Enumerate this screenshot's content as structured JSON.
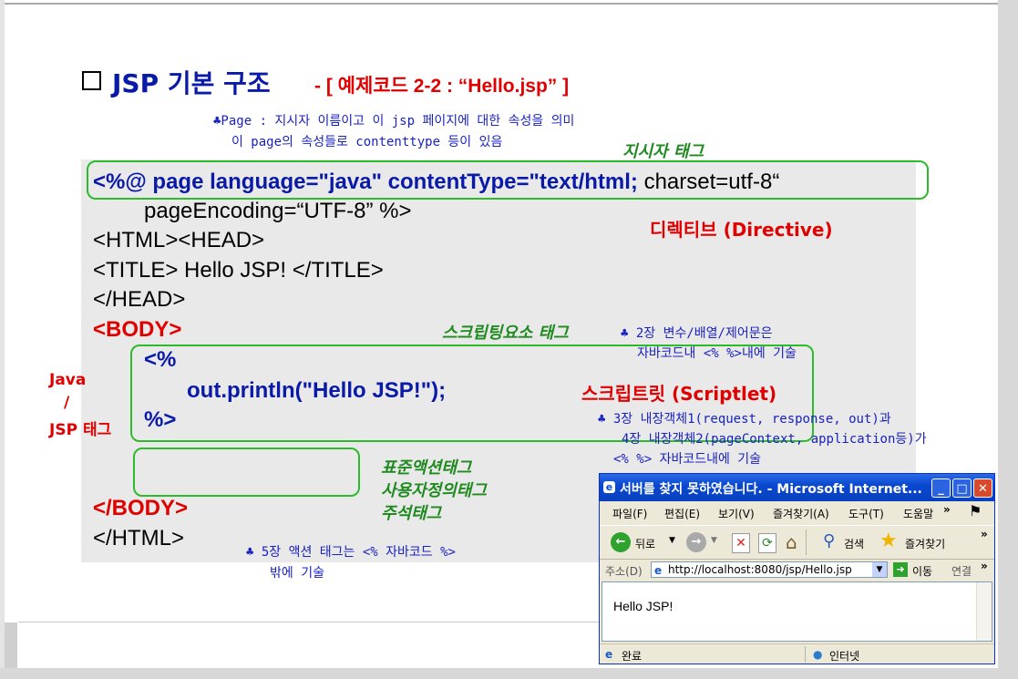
{
  "title": "JSP 기본 구조",
  "subtitle": "- [ 예제코드 2-2 : “Hello.jsp” ]",
  "notes": {
    "page_line1": "♣Page : 지시자 이름이고 이 jsp 페이지에 대한 속성을 의미",
    "page_line2": "이 page의 속성들로 contenttype 등이 있음",
    "scripting_line1": "♣ 2장 변수/배열/제어문은",
    "scripting_line2": "자바코드내 <%  %>내에 기술",
    "implicit_line1": "♣ 3장 내장객체1(request, response, out)과",
    "implicit_line2": "4장 내장객체2(pageContext, application등)가",
    "implicit_line3": "<%   %> 자바코드내에 기술",
    "action_line1": "♣ 5장 액션 태그는 <% 자바코드 %>",
    "action_line2": "밖에 기술"
  },
  "labels": {
    "directive_tag": "지시자 태그",
    "directive": "디렉티브 (Directive)",
    "scripting_tag": "스크립팅요소 태그",
    "scriptlet": "스크립트릿 (Scriptlet)",
    "java": "Java",
    "slash": "/",
    "jsp_tag": "JSP 태그",
    "std_action": "표준액션태그",
    "custom_tag": "사용자정의태그",
    "comment_tag": "주석태그"
  },
  "code": {
    "line1_bold": "<%@ page language=\"java\" contentType=\"text/html;",
    "line1_rest": " charset=utf-8“",
    "line2": "pageEncoding=“UTF-8” %>",
    "line3": "<HTML><HEAD>",
    "line4": "<TITLE> Hello JSP! </TITLE>",
    "line5": "</HEAD>",
    "line6": "<BODY>",
    "line7": "<%",
    "line8": "out.println(\"Hello JSP!\");",
    "line9": "%>",
    "line10": "</BODY>",
    "line11": "</HTML>"
  },
  "browser": {
    "title": "서버를 찾지 못하였습니다. - Microsoft Internet...",
    "menu": [
      "파일(F)",
      "편집(E)",
      "보기(V)",
      "즐겨찾기(A)",
      "도구(T)",
      "도움말"
    ],
    "back_label": "뒤로",
    "search_label": "검색",
    "favorites_label": "즐겨찾기",
    "address_label": "주소(D)",
    "url": "http://localhost:8080/jsp/Hello.jsp",
    "go_label": "이동",
    "links_label": "연결",
    "content": "Hello JSP!",
    "status_left": "완료",
    "status_zone": "인터넷"
  }
}
